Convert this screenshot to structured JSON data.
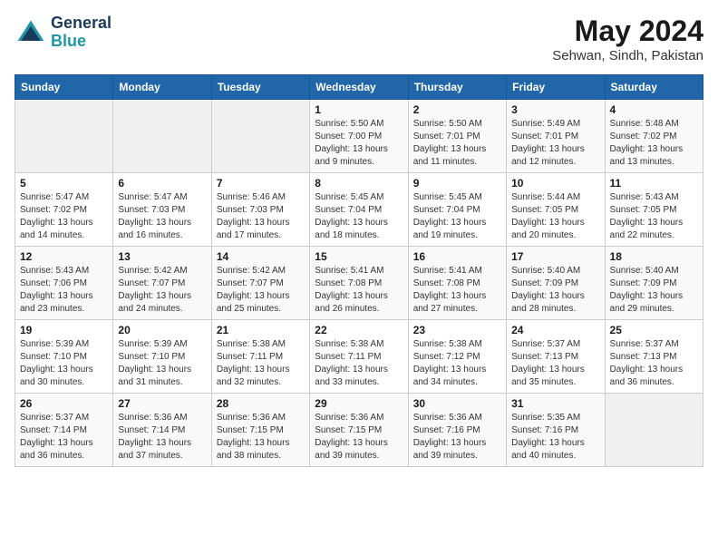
{
  "header": {
    "logo": {
      "line1": "General",
      "line2": "Blue"
    },
    "title": "May 2024",
    "subtitle": "Sehwan, Sindh, Pakistan"
  },
  "weekdays": [
    "Sunday",
    "Monday",
    "Tuesday",
    "Wednesday",
    "Thursday",
    "Friday",
    "Saturday"
  ],
  "weeks": [
    [
      {
        "day": "",
        "info": ""
      },
      {
        "day": "",
        "info": ""
      },
      {
        "day": "",
        "info": ""
      },
      {
        "day": "1",
        "info": "Sunrise: 5:50 AM\nSunset: 7:00 PM\nDaylight: 13 hours\nand 9 minutes."
      },
      {
        "day": "2",
        "info": "Sunrise: 5:50 AM\nSunset: 7:01 PM\nDaylight: 13 hours\nand 11 minutes."
      },
      {
        "day": "3",
        "info": "Sunrise: 5:49 AM\nSunset: 7:01 PM\nDaylight: 13 hours\nand 12 minutes."
      },
      {
        "day": "4",
        "info": "Sunrise: 5:48 AM\nSunset: 7:02 PM\nDaylight: 13 hours\nand 13 minutes."
      }
    ],
    [
      {
        "day": "5",
        "info": "Sunrise: 5:47 AM\nSunset: 7:02 PM\nDaylight: 13 hours\nand 14 minutes."
      },
      {
        "day": "6",
        "info": "Sunrise: 5:47 AM\nSunset: 7:03 PM\nDaylight: 13 hours\nand 16 minutes."
      },
      {
        "day": "7",
        "info": "Sunrise: 5:46 AM\nSunset: 7:03 PM\nDaylight: 13 hours\nand 17 minutes."
      },
      {
        "day": "8",
        "info": "Sunrise: 5:45 AM\nSunset: 7:04 PM\nDaylight: 13 hours\nand 18 minutes."
      },
      {
        "day": "9",
        "info": "Sunrise: 5:45 AM\nSunset: 7:04 PM\nDaylight: 13 hours\nand 19 minutes."
      },
      {
        "day": "10",
        "info": "Sunrise: 5:44 AM\nSunset: 7:05 PM\nDaylight: 13 hours\nand 20 minutes."
      },
      {
        "day": "11",
        "info": "Sunrise: 5:43 AM\nSunset: 7:05 PM\nDaylight: 13 hours\nand 22 minutes."
      }
    ],
    [
      {
        "day": "12",
        "info": "Sunrise: 5:43 AM\nSunset: 7:06 PM\nDaylight: 13 hours\nand 23 minutes."
      },
      {
        "day": "13",
        "info": "Sunrise: 5:42 AM\nSunset: 7:07 PM\nDaylight: 13 hours\nand 24 minutes."
      },
      {
        "day": "14",
        "info": "Sunrise: 5:42 AM\nSunset: 7:07 PM\nDaylight: 13 hours\nand 25 minutes."
      },
      {
        "day": "15",
        "info": "Sunrise: 5:41 AM\nSunset: 7:08 PM\nDaylight: 13 hours\nand 26 minutes."
      },
      {
        "day": "16",
        "info": "Sunrise: 5:41 AM\nSunset: 7:08 PM\nDaylight: 13 hours\nand 27 minutes."
      },
      {
        "day": "17",
        "info": "Sunrise: 5:40 AM\nSunset: 7:09 PM\nDaylight: 13 hours\nand 28 minutes."
      },
      {
        "day": "18",
        "info": "Sunrise: 5:40 AM\nSunset: 7:09 PM\nDaylight: 13 hours\nand 29 minutes."
      }
    ],
    [
      {
        "day": "19",
        "info": "Sunrise: 5:39 AM\nSunset: 7:10 PM\nDaylight: 13 hours\nand 30 minutes."
      },
      {
        "day": "20",
        "info": "Sunrise: 5:39 AM\nSunset: 7:10 PM\nDaylight: 13 hours\nand 31 minutes."
      },
      {
        "day": "21",
        "info": "Sunrise: 5:38 AM\nSunset: 7:11 PM\nDaylight: 13 hours\nand 32 minutes."
      },
      {
        "day": "22",
        "info": "Sunrise: 5:38 AM\nSunset: 7:11 PM\nDaylight: 13 hours\nand 33 minutes."
      },
      {
        "day": "23",
        "info": "Sunrise: 5:38 AM\nSunset: 7:12 PM\nDaylight: 13 hours\nand 34 minutes."
      },
      {
        "day": "24",
        "info": "Sunrise: 5:37 AM\nSunset: 7:13 PM\nDaylight: 13 hours\nand 35 minutes."
      },
      {
        "day": "25",
        "info": "Sunrise: 5:37 AM\nSunset: 7:13 PM\nDaylight: 13 hours\nand 36 minutes."
      }
    ],
    [
      {
        "day": "26",
        "info": "Sunrise: 5:37 AM\nSunset: 7:14 PM\nDaylight: 13 hours\nand 36 minutes."
      },
      {
        "day": "27",
        "info": "Sunrise: 5:36 AM\nSunset: 7:14 PM\nDaylight: 13 hours\nand 37 minutes."
      },
      {
        "day": "28",
        "info": "Sunrise: 5:36 AM\nSunset: 7:15 PM\nDaylight: 13 hours\nand 38 minutes."
      },
      {
        "day": "29",
        "info": "Sunrise: 5:36 AM\nSunset: 7:15 PM\nDaylight: 13 hours\nand 39 minutes."
      },
      {
        "day": "30",
        "info": "Sunrise: 5:36 AM\nSunset: 7:16 PM\nDaylight: 13 hours\nand 39 minutes."
      },
      {
        "day": "31",
        "info": "Sunrise: 5:35 AM\nSunset: 7:16 PM\nDaylight: 13 hours\nand 40 minutes."
      },
      {
        "day": "",
        "info": ""
      }
    ]
  ]
}
